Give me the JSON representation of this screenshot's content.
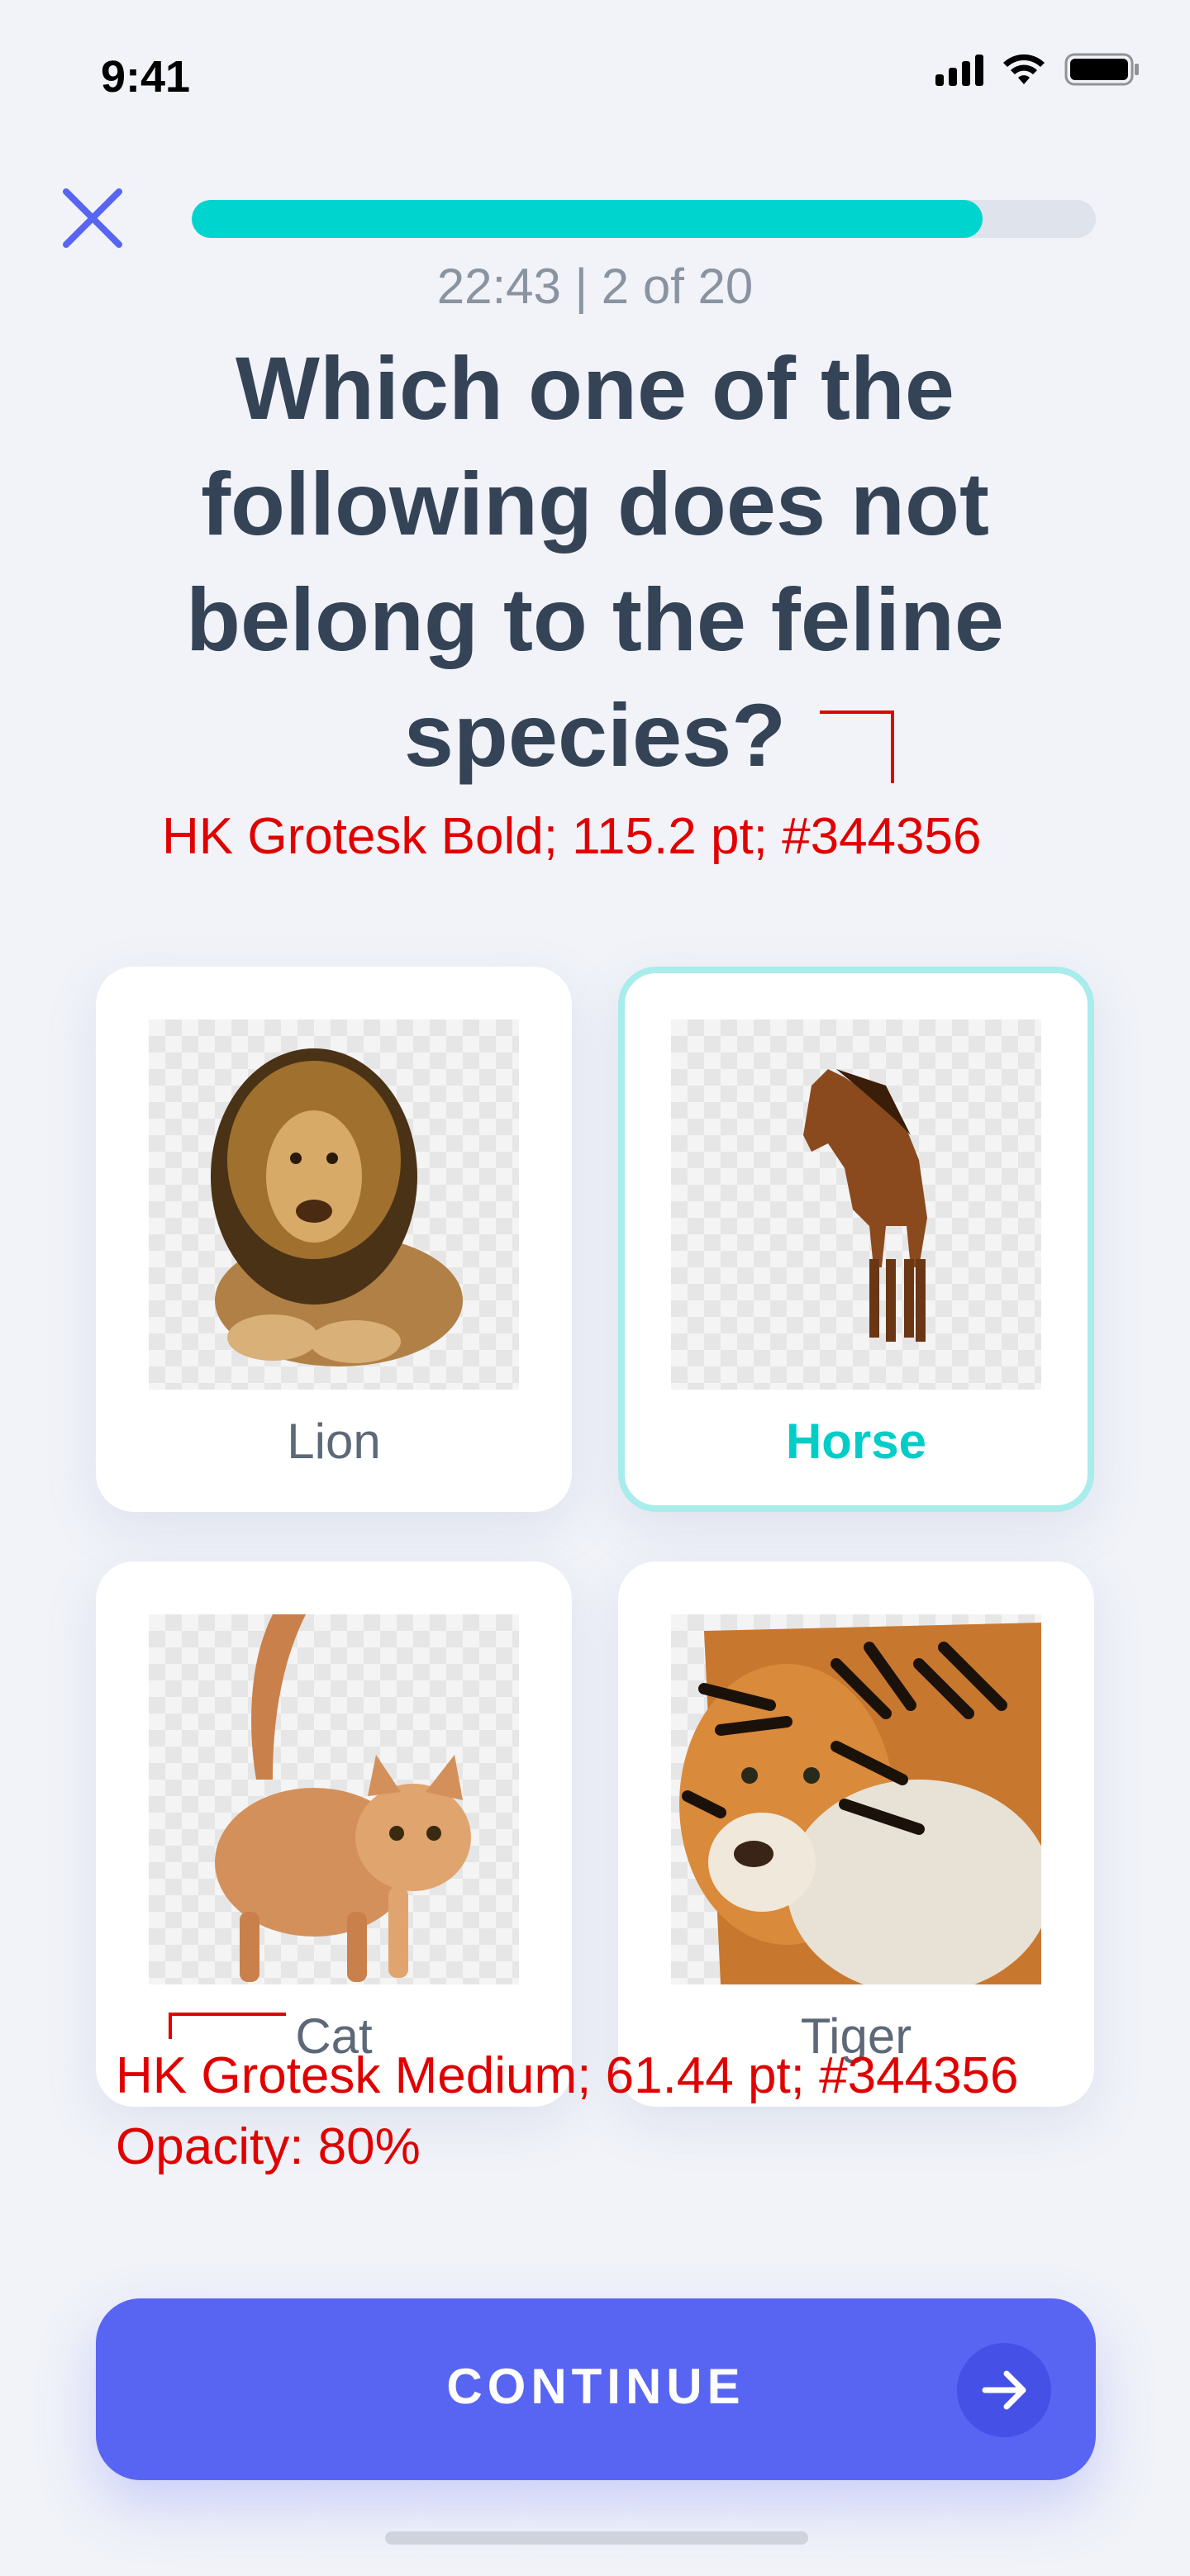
{
  "status_bar": {
    "time": "9:41",
    "icons": [
      "cellular-signal-icon",
      "wifi-icon",
      "battery-icon"
    ]
  },
  "header": {
    "close_icon": "close-icon",
    "progress_fraction": 0.875,
    "timer_text": "22:43 | 2 of 20"
  },
  "question": {
    "part1": "Which one of the following ",
    "emphasis": "does not",
    "part2": " belong to the feline species?"
  },
  "annotations": {
    "question_spec": "HK Grotesk Bold; 115.2 pt; #344356",
    "label_spec_line1": "HK Grotesk Medium; 61.44 pt; #344356",
    "label_spec_line2": "Opacity: 80%"
  },
  "options": [
    {
      "label": "Lion",
      "selected": false
    },
    {
      "label": "Horse",
      "selected": true
    },
    {
      "label": "Cat",
      "selected": false
    },
    {
      "label": "Tiger",
      "selected": false
    }
  ],
  "continue_button": {
    "label": "CONTINUE",
    "icon": "arrow-right-icon"
  },
  "colors": {
    "text": "#344356",
    "accent": "#00d4ce",
    "primary": "#5865f2",
    "background": "#f1f3f9",
    "annotation": "#e00000"
  }
}
